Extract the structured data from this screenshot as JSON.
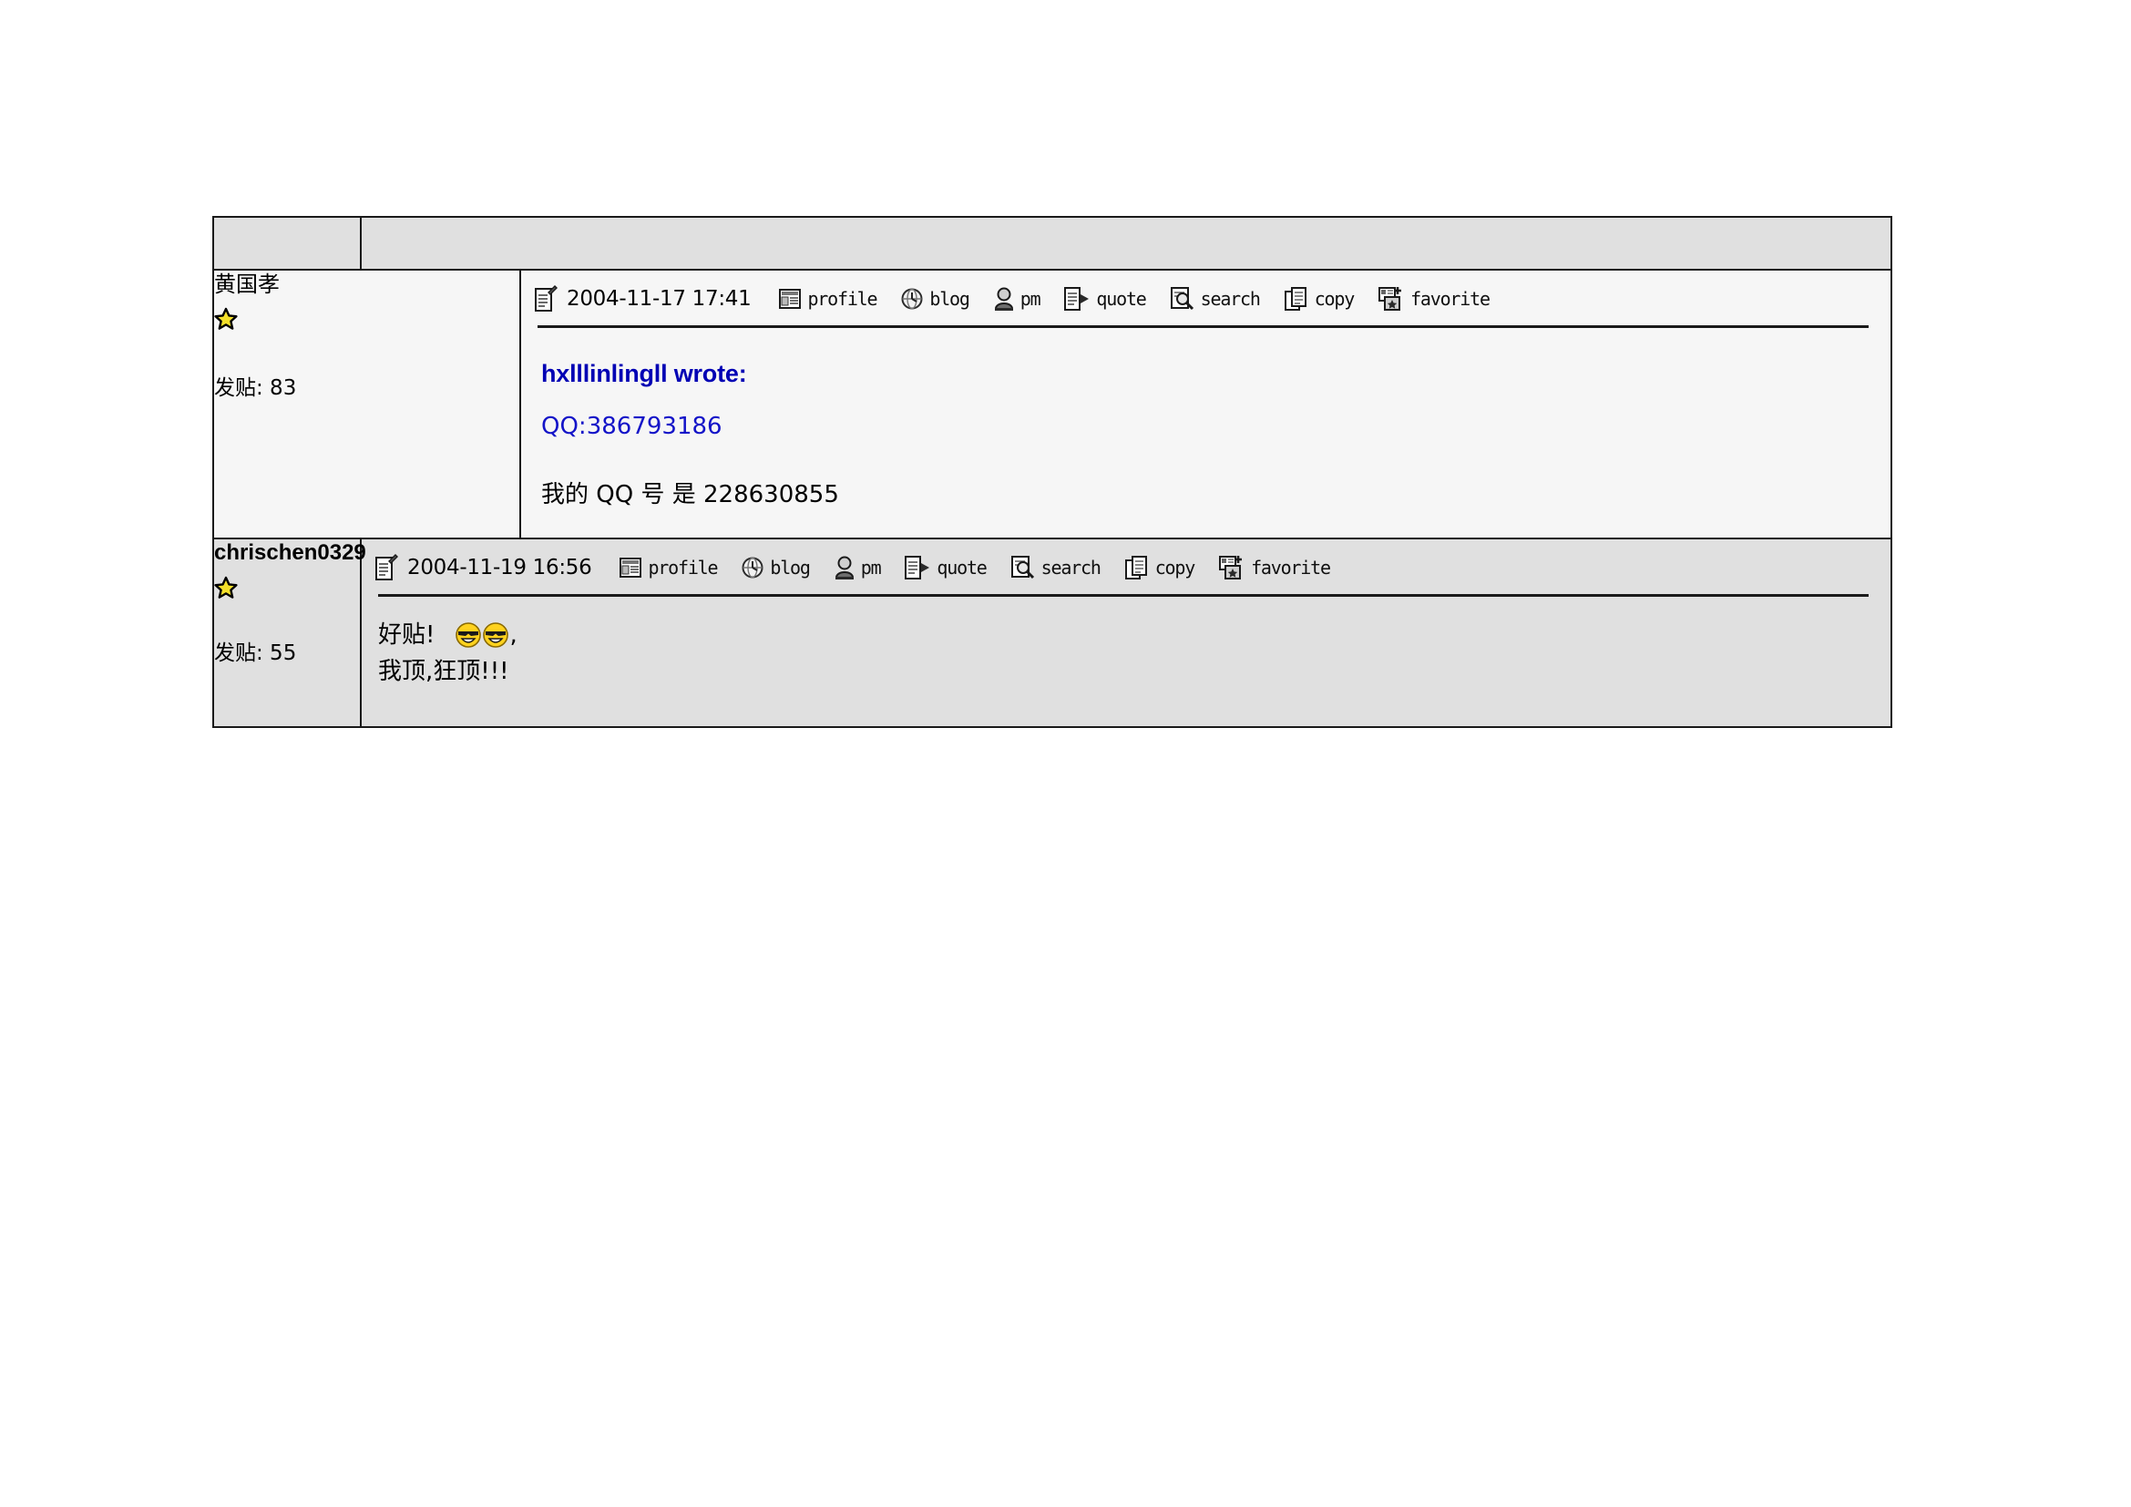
{
  "header": {
    "left_cell_label": "",
    "right_cell_label": ""
  },
  "toolbar_buttons": [
    {
      "icon": "profile-icon",
      "label": "profile"
    },
    {
      "icon": "blog-icon",
      "label": "blog"
    },
    {
      "icon": "pm-icon",
      "label": "pm"
    },
    {
      "icon": "quote-icon",
      "label": "quote"
    },
    {
      "icon": "search-icon",
      "label": "search"
    },
    {
      "icon": "copy-icon",
      "label": "copy"
    },
    {
      "icon": "favorite-icon",
      "label": "favorite"
    }
  ],
  "posts": [
    {
      "author": "黄国孝",
      "rank_icon": "star-icon",
      "post_count_label": "发贴: 83",
      "date_icon": "post-note-icon",
      "date": "2004-11-17 17:41",
      "quote_header": "hxlllinlingll wrote:",
      "quote_body": "QQ:386793186",
      "body_text": "我的 QQ 号  是 228630855"
    },
    {
      "author": "chrischen0329",
      "rank_icon": "star-icon",
      "post_count_label": "发贴: 55",
      "date_icon": "post-note-icon",
      "date": "2004-11-19 16:56",
      "line1_before": "好贴!",
      "line1_smilies": [
        "cool-smiley",
        "cool-smiley"
      ],
      "line1_after": ",",
      "line2": "我顶,狂顶!!!"
    }
  ],
  "colors": {
    "header_bg": "#e0e0e0",
    "post1_bg": "#f6f6f6",
    "post2_bg": "#e0e0e0",
    "border": "#1a1a1a",
    "quote_blue": "#0000b4",
    "quote_body_blue": "#1414c8",
    "star_yellow": "#ffe000",
    "smiley_yellow": "#ffd700"
  }
}
